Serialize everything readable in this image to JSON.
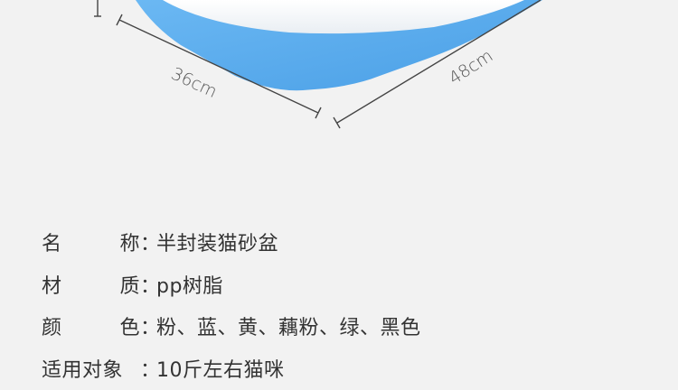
{
  "dimensions": {
    "depth": "36cm",
    "width": "48cm"
  },
  "colors": {
    "background": "#f2f2f2",
    "tray_blue": "#5aaef0",
    "tray_blue_dark": "#4a9fe6",
    "cover_white": "#fdfdfd",
    "line": "#444444",
    "text": "#333333"
  },
  "specs": [
    {
      "label_a": "名",
      "label_b": "称",
      "separator": "：",
      "value": "半封装猫砂盆"
    },
    {
      "label_a": "材",
      "label_b": "质",
      "separator": "：",
      "value": "pp树脂"
    },
    {
      "label_a": "颜",
      "label_b": "色",
      "separator": "：",
      "value": "粉、蓝、黄、藕粉、绿、黑色"
    },
    {
      "label_full": "适用对象",
      "separator": "：",
      "value": "10斤左右猫咪"
    }
  ]
}
